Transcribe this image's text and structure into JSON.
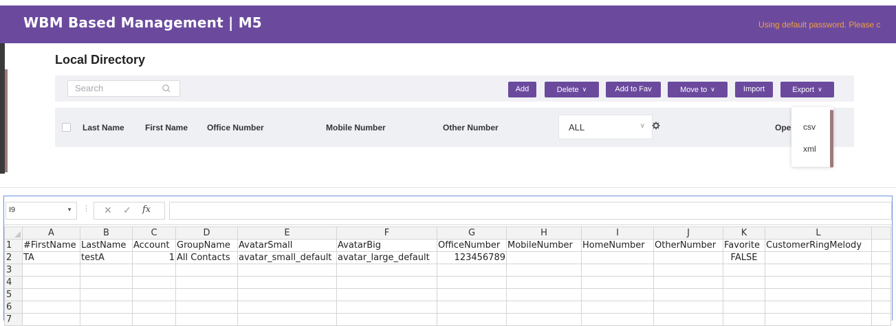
{
  "app": {
    "title": "WBM Based Management | M5",
    "warning": "Using default password. Please c"
  },
  "page": {
    "title": "Local Directory"
  },
  "search": {
    "placeholder": "Search"
  },
  "toolbar": {
    "add": "Add",
    "delete": "Delete",
    "add_to_fav": "Add to Fav",
    "move_to": "Move to",
    "import": "Import",
    "export": "Export"
  },
  "table_header": {
    "last_name": "Last Name",
    "first_name": "First Name",
    "office_number": "Office Number",
    "mobile_number": "Mobile Number",
    "other_number": "Other Number",
    "group_filter": "ALL",
    "operation": "Ope"
  },
  "export_menu": [
    "csv",
    "xml"
  ],
  "spreadsheet": {
    "name_box": "I9",
    "function_icon": "fx",
    "columns": [
      "A",
      "B",
      "C",
      "D",
      "E",
      "F",
      "G",
      "H",
      "I",
      "J",
      "K",
      "L"
    ],
    "rows": [
      {
        "n": "1",
        "cells": [
          "#FirstName",
          "LastName",
          "Account",
          "GroupName",
          "AvatarSmall",
          "AvatarBig",
          "OfficeNumber",
          "MobileNumber",
          "HomeNumber",
          "OtherNumber",
          "Favorite",
          "CustomerRingMelody"
        ]
      },
      {
        "n": "2",
        "cells": [
          "TA",
          "testA",
          "1",
          "All Contacts",
          "avatar_small_default",
          "avatar_large_default",
          "123456789",
          "",
          "",
          "",
          "FALSE",
          ""
        ]
      },
      {
        "n": "3",
        "cells": [
          "",
          "",
          "",
          "",
          "",
          "",
          "",
          "",
          "",
          "",
          "",
          ""
        ]
      },
      {
        "n": "4",
        "cells": [
          "",
          "",
          "",
          "",
          "",
          "",
          "",
          "",
          "",
          "",
          "",
          ""
        ]
      },
      {
        "n": "5",
        "cells": [
          "",
          "",
          "",
          "",
          "",
          "",
          "",
          "",
          "",
          "",
          "",
          ""
        ]
      },
      {
        "n": "6",
        "cells": [
          "",
          "",
          "",
          "",
          "",
          "",
          "",
          "",
          "",
          "",
          "",
          ""
        ]
      },
      {
        "n": "7",
        "cells": [
          "",
          "",
          "",
          "",
          "",
          "",
          "",
          "",
          "",
          "",
          "",
          ""
        ]
      }
    ]
  },
  "colors": {
    "brand": "#6b4a9e",
    "warning": "#f0a040"
  }
}
